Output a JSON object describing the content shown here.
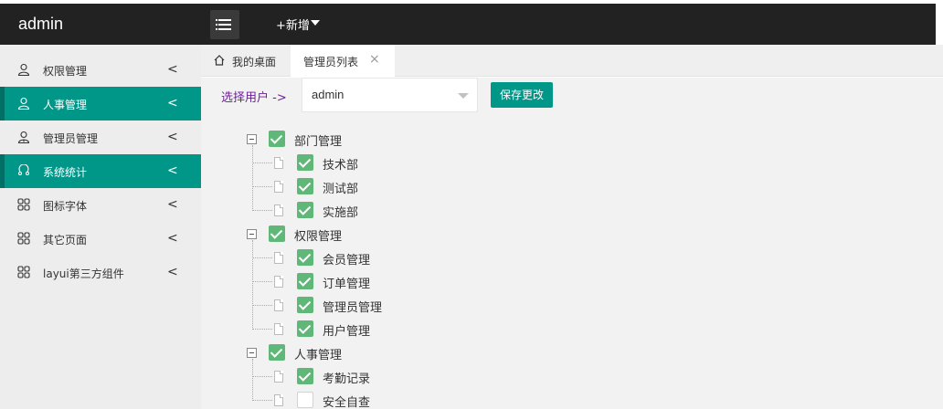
{
  "app": {
    "title": "admin"
  },
  "header": {
    "add_label": "+新增"
  },
  "sidebar": {
    "items": [
      {
        "label": "权限管理",
        "arrow": "<",
        "icon": "user-icon",
        "active": false
      },
      {
        "label": "人事管理",
        "arrow": "<",
        "icon": "user-icon",
        "active": true
      },
      {
        "label": "管理员管理",
        "arrow": "<",
        "icon": "admin-user-icon",
        "active": false
      },
      {
        "label": "系统统计",
        "arrow": "<",
        "icon": "stats-icon",
        "active": true
      },
      {
        "label": "图标字体",
        "arrow": "<",
        "icon": "grid-icon",
        "active": false
      },
      {
        "label": "其它页面",
        "arrow": "<",
        "icon": "grid-icon",
        "active": false
      },
      {
        "label": "layui第三方组件",
        "arrow": "<",
        "icon": "grid-icon",
        "active": false
      }
    ]
  },
  "tabs": {
    "home_label": "我的桌面",
    "current_label": "管理员列表",
    "close_glyph": "×"
  },
  "content": {
    "select_label": "选择用户 ->",
    "select_value": "admin",
    "save_label": "保存更改"
  },
  "tree": [
    {
      "label": "部门管理",
      "checked": true,
      "children": [
        {
          "label": "技术部",
          "checked": true
        },
        {
          "label": "测试部",
          "checked": true
        },
        {
          "label": "实施部",
          "checked": true
        }
      ]
    },
    {
      "label": "权限管理",
      "checked": true,
      "children": [
        {
          "label": "会员管理",
          "checked": true
        },
        {
          "label": "订单管理",
          "checked": true
        },
        {
          "label": "管理员管理",
          "checked": true
        },
        {
          "label": "用户管理",
          "checked": true
        }
      ]
    },
    {
      "label": "人事管理",
      "checked": true,
      "children": [
        {
          "label": "考勤记录",
          "checked": true
        },
        {
          "label": "安全自查",
          "checked": false
        }
      ]
    }
  ],
  "colors": {
    "accent": "#009688",
    "header": "#222222",
    "checkbox": "#5fb878",
    "link": "#6d1f9c"
  }
}
